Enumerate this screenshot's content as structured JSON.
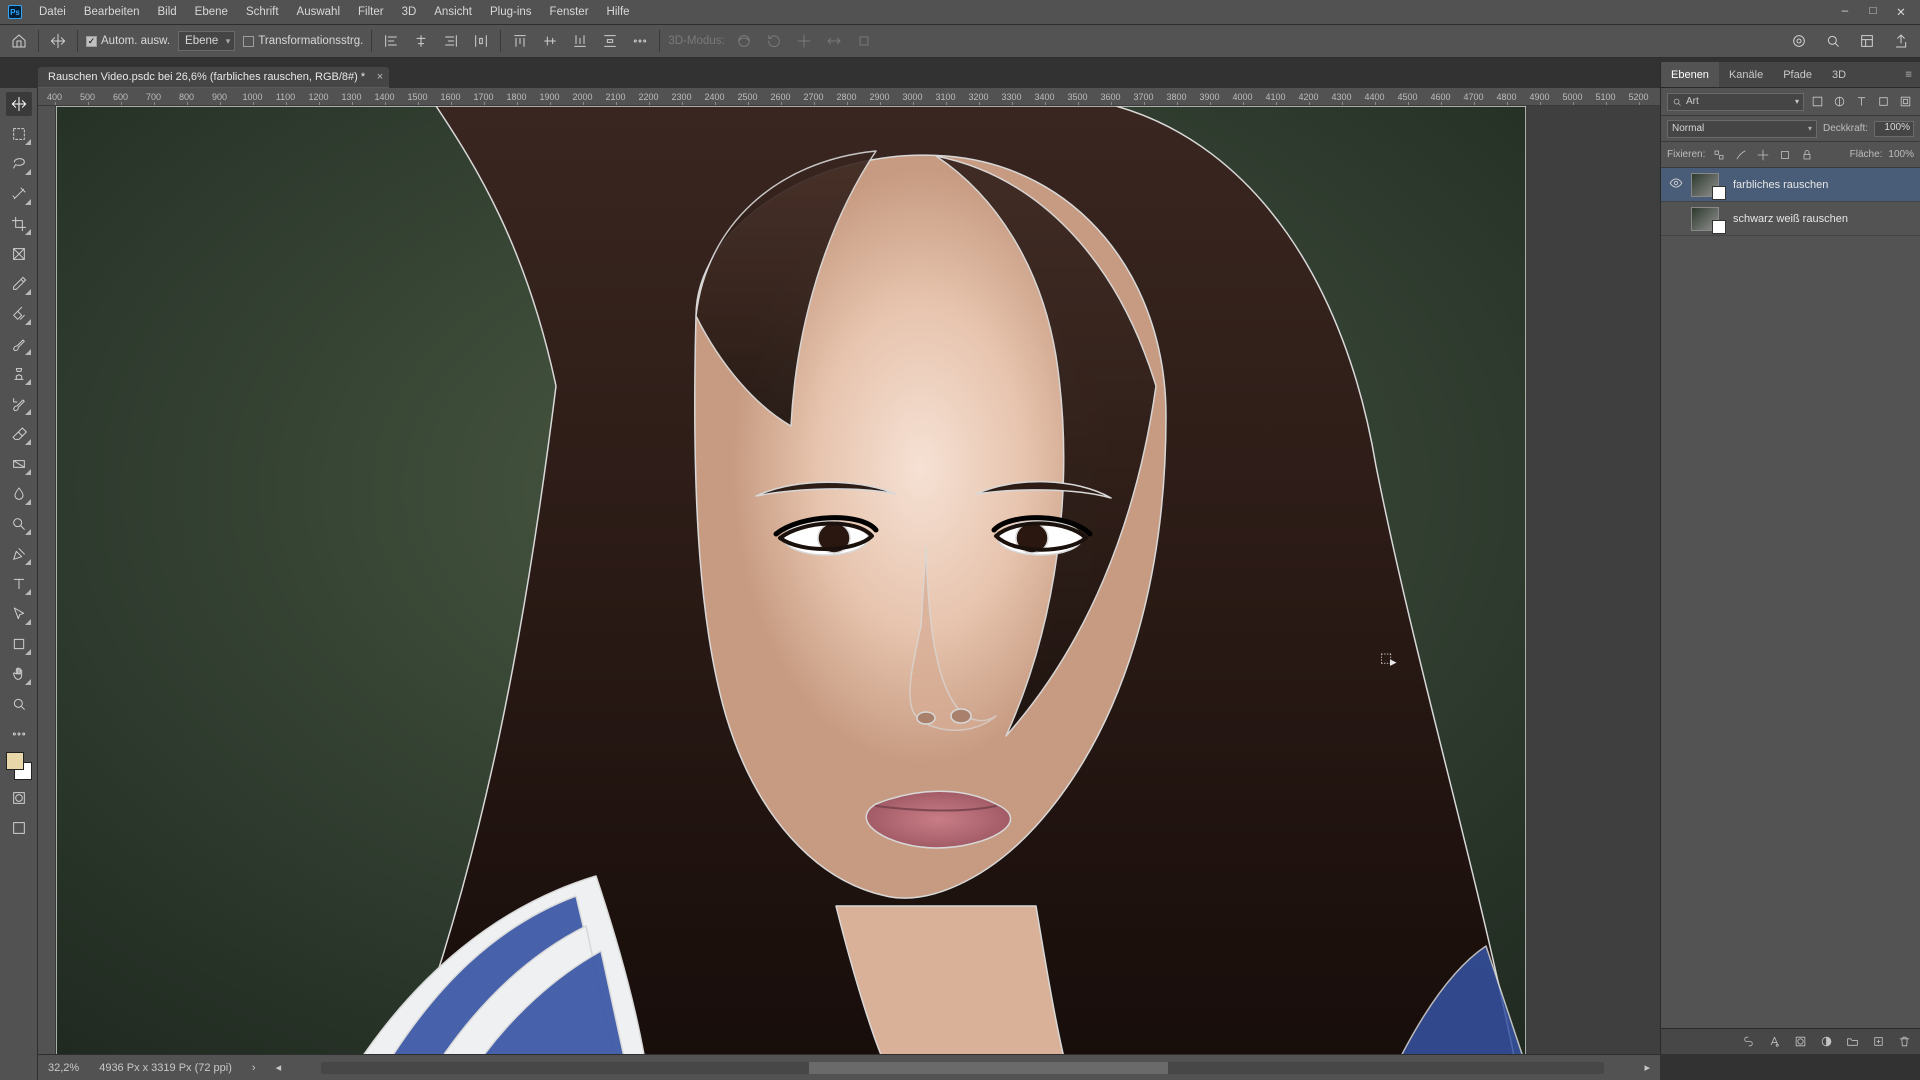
{
  "app_icon": "Ps",
  "menu": [
    "Datei",
    "Bearbeiten",
    "Bild",
    "Ebene",
    "Schrift",
    "Auswahl",
    "Filter",
    "3D",
    "Ansicht",
    "Plug-ins",
    "Fenster",
    "Hilfe"
  ],
  "window_buttons": [
    "–",
    "□",
    "✕"
  ],
  "options": {
    "auto_select_label": "Autom. ausw.",
    "target_label": "Ebene",
    "transform_label": "Transformationsstrg.",
    "mode3d_label": "3D-Modus:"
  },
  "doc_tab": {
    "title": "Rauschen Video.psdc bei 26,6% (farbliches rauschen, RGB/8#) *"
  },
  "ruler_ticks": [
    "400",
    "500",
    "600",
    "700",
    "800",
    "900",
    "1000",
    "1100",
    "1200",
    "1300",
    "1400",
    "1500",
    "1600",
    "1700",
    "1800",
    "1900",
    "2000",
    "2100",
    "2200",
    "2300",
    "2400",
    "2500",
    "2600",
    "2700",
    "2800",
    "2900",
    "3000",
    "3100",
    "3200",
    "3300",
    "3400",
    "3500",
    "3600",
    "3700",
    "3800",
    "3900",
    "4000",
    "4100",
    "4200",
    "4300",
    "4400",
    "4500",
    "4600",
    "4700",
    "4800",
    "4900",
    "5000",
    "5100",
    "5200"
  ],
  "tools": [
    {
      "name": "move-tool",
      "active": true,
      "tri": false
    },
    {
      "name": "marquee-tool",
      "tri": true
    },
    {
      "name": "lasso-tool",
      "tri": true
    },
    {
      "name": "magic-wand-tool",
      "tri": true
    },
    {
      "name": "crop-tool",
      "tri": true
    },
    {
      "name": "frame-tool",
      "tri": false
    },
    {
      "name": "eyedropper-tool",
      "tri": true
    },
    {
      "name": "healing-brush-tool",
      "tri": true
    },
    {
      "name": "brush-tool",
      "tri": true
    },
    {
      "name": "clone-stamp-tool",
      "tri": true
    },
    {
      "name": "history-brush-tool",
      "tri": true
    },
    {
      "name": "eraser-tool",
      "tri": true
    },
    {
      "name": "gradient-tool",
      "tri": true
    },
    {
      "name": "blur-tool",
      "tri": true
    },
    {
      "name": "dodge-tool",
      "tri": true
    },
    {
      "name": "pen-tool",
      "tri": true
    },
    {
      "name": "type-tool",
      "tri": true
    },
    {
      "name": "path-select-tool",
      "tri": true
    },
    {
      "name": "shape-tool",
      "tri": true
    },
    {
      "name": "hand-tool",
      "tri": true
    },
    {
      "name": "zoom-tool",
      "tri": false
    },
    {
      "name": "edit-toolbar",
      "tri": false
    }
  ],
  "panel": {
    "tabs": [
      "Ebenen",
      "Kanäle",
      "Pfade",
      "3D"
    ],
    "search_label": "Art",
    "blend_mode": "Normal",
    "opacity_label": "Deckkraft:",
    "opacity_value": "100%",
    "lock_label": "Fixieren:",
    "fill_label": "Fläche:",
    "fill_value": "100%",
    "layers": [
      {
        "visible": true,
        "name": "farbliches rauschen",
        "selected": true
      },
      {
        "visible": false,
        "name": "schwarz weiß rauschen",
        "selected": false
      }
    ]
  },
  "status": {
    "zoom": "32,2%",
    "info": "4936 Px x 3319 Px  (72 ppi)"
  }
}
